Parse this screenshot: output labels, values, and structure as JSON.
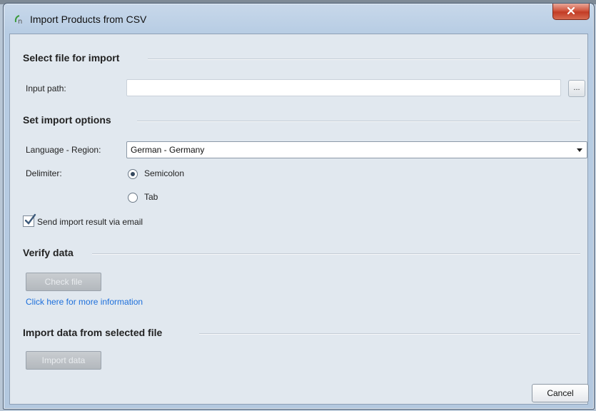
{
  "window": {
    "title": "Import Products from CSV"
  },
  "sections": {
    "select_file": "Select file for import",
    "import_options": "Set import options",
    "verify": "Verify data",
    "import": "Import data from selected file"
  },
  "file": {
    "input_path_label": "Input path:",
    "input_path_value": "",
    "browse_label": "..."
  },
  "options": {
    "language_label": "Language - Region:",
    "language_value": "German - Germany",
    "delimiter_label": "Delimiter:",
    "delimiters": [
      {
        "label": "Semicolon",
        "checked": true
      },
      {
        "label": "Tab",
        "checked": false
      }
    ],
    "email_label": "Send import result via email",
    "email_checked": true
  },
  "verify": {
    "check_file_label": "Check file",
    "more_info_link": "Click here for more information"
  },
  "import": {
    "import_data_label": "Import data"
  },
  "footer": {
    "cancel_label": "Cancel"
  },
  "colors": {
    "link": "#1d6fdb",
    "close_button": "#c23c25",
    "title_bar": "#b8cde4"
  }
}
